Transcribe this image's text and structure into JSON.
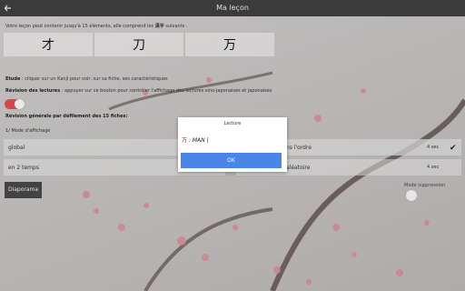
{
  "app": {
    "title": "Ma leçon"
  },
  "intro": {
    "before": "Votre leçon peut contenir jusqu'à 15 éléments, elle comprend les ",
    "kanji_word": "漢字",
    "after": " suivants :"
  },
  "kanji": [
    "才",
    "刀",
    "万"
  ],
  "etude": {
    "label": "Etude",
    "text": " : cliquer sur un Kanji pour voir, sur sa fiche, ses caractéristiques"
  },
  "revision_lectures": {
    "label": "Révision des lectures",
    "text": " : appuyer sur ce bouton pour contrôler l'affichage des lectures sino-japonaises et japonaises"
  },
  "revision_generale": {
    "label": "Révision générale par défilement des 15 fiches:"
  },
  "mode_affichage": {
    "label": "1/ Mode d'affichage"
  },
  "options_left": [
    {
      "label": "global"
    },
    {
      "label": "en 2 temps"
    }
  ],
  "options_right": [
    {
      "label": "ns l'ordre",
      "meta": "4 sec"
    },
    {
      "label": "aléatoire",
      "meta": "4 sec"
    }
  ],
  "right_panel": {
    "mode_supp": "Mode suppression"
  },
  "diapo": {
    "label": "Diaporama"
  },
  "dialog": {
    "title": "Lecture",
    "kanji": "万",
    "reading": " : MAN |",
    "ok": "OK"
  },
  "colors": {
    "accent": "#e34b4b",
    "ok_button": "#4a86e8"
  }
}
